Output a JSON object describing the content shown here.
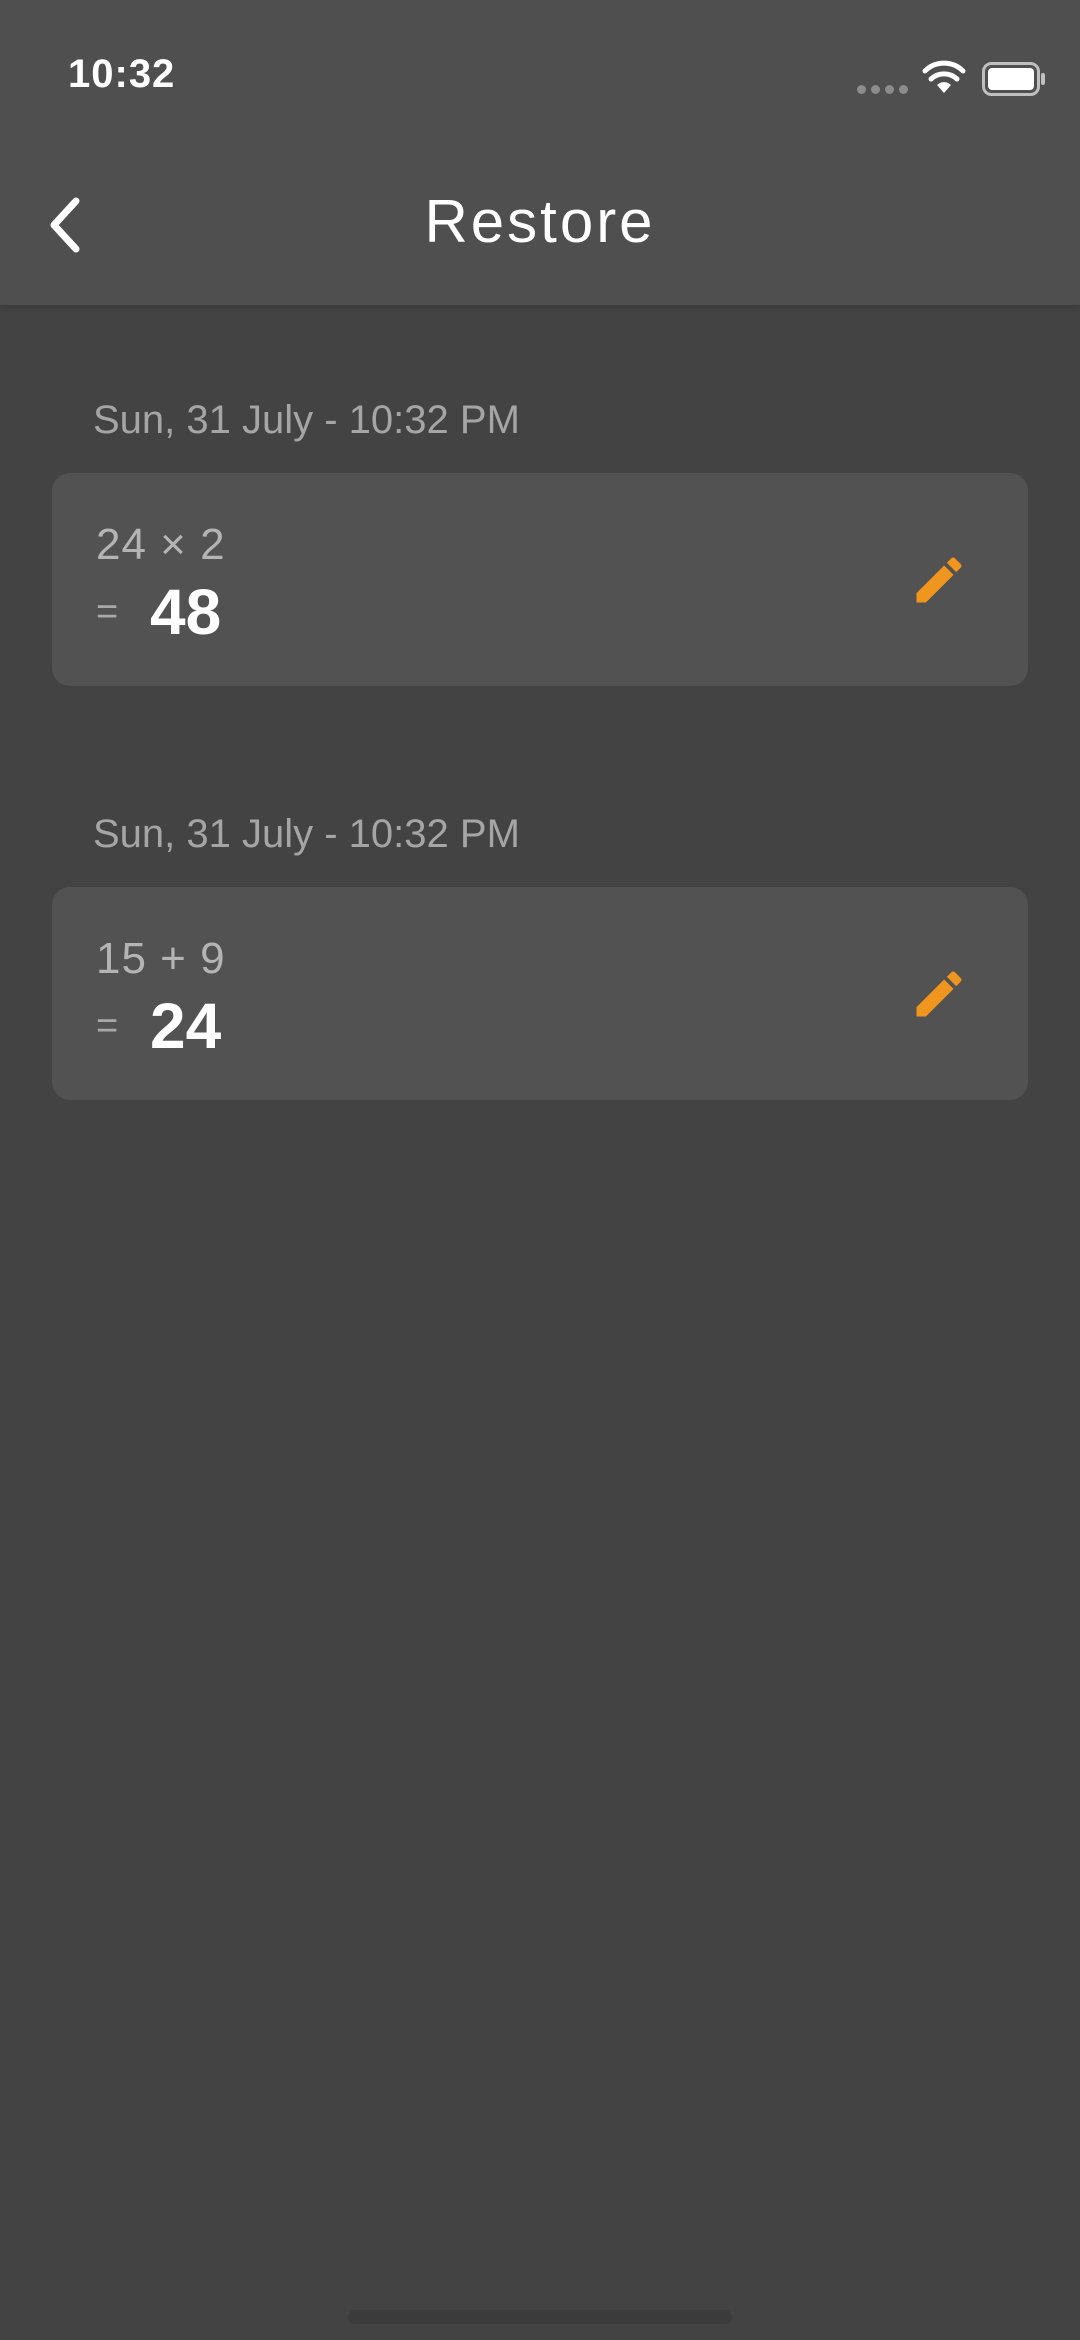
{
  "status_bar": {
    "time": "10:32",
    "icons": [
      "signal-dots-icon",
      "wifi-icon",
      "battery-icon"
    ]
  },
  "nav": {
    "back_icon": "chevron-left-icon",
    "title": "Restore"
  },
  "entries": [
    {
      "date": "Sun, 31 July - 10:32 PM",
      "expression": "24 × 2",
      "equals": "=",
      "result": "48",
      "edit_icon": "pencil-icon"
    },
    {
      "date": "Sun, 31 July - 10:32 PM",
      "expression": "15 + 9",
      "equals": "=",
      "result": "24",
      "edit_icon": "pencil-icon"
    }
  ],
  "colors": {
    "background": "#434343",
    "header": "#4f4f4f",
    "card": "#525252",
    "accent": "#f0951d",
    "muted_text": "#a5a5a5"
  }
}
